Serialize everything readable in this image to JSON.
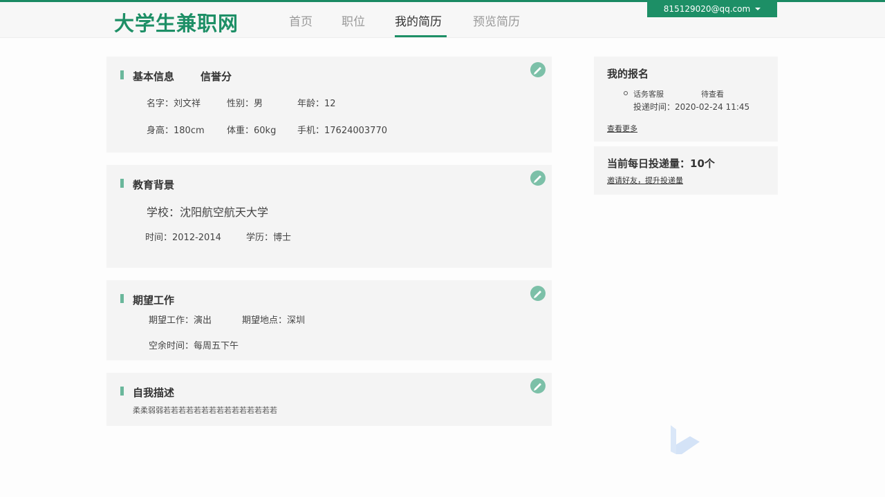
{
  "header": {
    "logo": "大学生兼职网",
    "nav": [
      "首页",
      "职位",
      "我的简历",
      "预览简历"
    ],
    "active_nav": "我的简历",
    "user_email": "815129020@qq.com"
  },
  "basic_info": {
    "title": "基本信息",
    "credit_label": "信誉分",
    "name": "名字：刘文祥",
    "gender": "性别：男",
    "age": "年龄：12",
    "height": "身高：180cm",
    "weight": "体重：60kg",
    "phone": "手机：17624003770"
  },
  "education": {
    "title": "教育背景",
    "school": "学校：沈阳航空航天大学",
    "time": "时间：2012-2014",
    "degree": "学历：博士"
  },
  "expected_job": {
    "title": "期望工作",
    "job": "期望工作：演出",
    "location": "期望地点：深圳",
    "free_time": "空余时间：每周五下午"
  },
  "self_desc": {
    "title": "自我描述",
    "text": "柔柔弱弱若若若若若若若若若若若若若若若"
  },
  "my_applications": {
    "title": "我的报名",
    "items": [
      {
        "job": "话务客服",
        "status": "待查看",
        "time": "投递时间：2020-02-24 11:45"
      }
    ],
    "more_link": "查看更多"
  },
  "daily_quota": {
    "title": "当前每日投递量：10个",
    "invite_link": "邀请好友，提升投递量"
  },
  "colors": {
    "brand": "#1d8f66",
    "accent_light": "#6ab79b",
    "card_bg": "#f4f4f4"
  }
}
